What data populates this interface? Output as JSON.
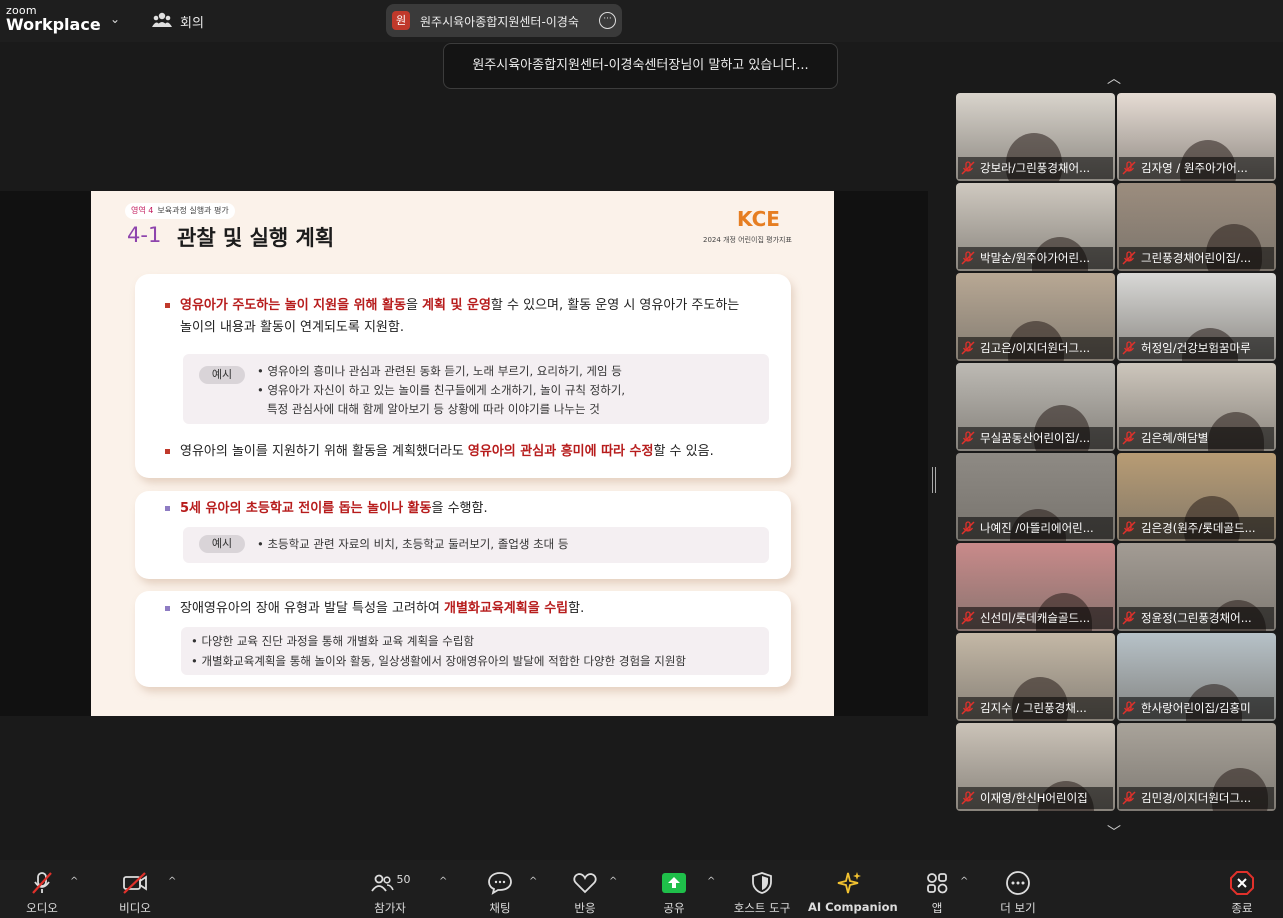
{
  "topbar": {
    "logo_small": "zoom",
    "logo_big": "Workplace",
    "meeting_label": "회의",
    "speaker_avatar": "원",
    "speaker_name": "원주시육아종합지원센터-이경숙"
  },
  "toast": "원주시육아종합지원센터-이경숙센터장님이 말하고 있습니다...",
  "slide": {
    "tag_area": "영역 4",
    "tag_text": "보육과정 실행과 평가",
    "number": "4-1",
    "title": "관찰 및 실행 계획",
    "logo": "KCE",
    "logo_sub": "2024 개정 어린이집 평가지표",
    "card1": {
      "b1_r1": "영유아가 주도하는 놀이 지원을 위해 활동",
      "b1_n1": "을 ",
      "b1_r2": "계획 및 운영",
      "b1_n2": "할 수 있으며, 활동 운영 시 영유아가 주도하는",
      "b1_line2": "놀이의 내용과 활동이 연계되도록 지원함.",
      "example_label": "예시",
      "ex_line1": "• 영유아의 흥미나 관심과 관련된 동화 듣기, 노래 부르기, 요리하기, 게임 등",
      "ex_line2": "• 영유아가 자신이 하고 있는 놀이를 친구들에게 소개하기, 놀이 규칙 정하기,",
      "ex_line3": "특정 관심사에 대해 함께 알아보기 등 상황에 따라 이야기를 나누는 것",
      "b2_n1": "영유아의 놀이를 지원하기 위해 활동을 계획했더라도 ",
      "b2_r1": "영유아의 관심과 흥미에 따라 수정",
      "b2_n2": "할 수 있음."
    },
    "card2": {
      "b_r1": "5세 유아의 초등학교 전이를 돕는 놀이나 활동",
      "b_n1": "을 수행함.",
      "example_label": "예시",
      "ex_line1": "• 초등학교 관련 자료의 비치, 초등학교 둘러보기,  졸업생 초대 등"
    },
    "card3": {
      "b_n1": "장애영유아의 장애 유형과 발달 특성을 고려하여 ",
      "b_r1": "개별화교육계획을 수립",
      "b_n2": "함.",
      "ex_line1": "• 다양한 교육 진단 과정을 통해 개별화 교육 계획을 수립함",
      "ex_line2": "• 개별화교육계획을 통해 놀이와 활동, 일상생활에서 장애영유아의 발달에 적합한 다양한 경험을 지원함"
    }
  },
  "participants": [
    {
      "name": "강보라/그린풍경채어...",
      "bg": "#d9d4cc"
    },
    {
      "name": "김자영 / 원주아가어...",
      "bg": "#e6dcd4"
    },
    {
      "name": "박말순/원주아가어린...",
      "bg": "#cfc9c0"
    },
    {
      "name": "그린풍경채어린이집/...",
      "bg": "#9c8d7e"
    },
    {
      "name": "김고은/이지더원더그...",
      "bg": "#b8a894"
    },
    {
      "name": "허정임/건강보험꿈마루",
      "bg": "#d8d8d6"
    },
    {
      "name": "무실꿈동산어린이집/...",
      "bg": "#bdbab4"
    },
    {
      "name": "김은혜/해담별",
      "bg": "#cdc6bc"
    },
    {
      "name": "나예진 /아뜰리에어린...",
      "bg": "#8e8a84"
    },
    {
      "name": "김은경(원주/롯데골드...",
      "bg": "#b89c74"
    },
    {
      "name": "신선미/롯데캐슬골드...",
      "bg": "#c98a8a"
    },
    {
      "name": "정윤정(그린풍경채어...",
      "bg": "#a39c94"
    },
    {
      "name": "김지수 / 그린풍경채...",
      "bg": "#c4b8a6"
    },
    {
      "name": "한사랑어린이집/김홍미",
      "bg": "#b7c2c8"
    },
    {
      "name": "이재영/한신H어린이집",
      "bg": "#cbc3b8"
    },
    {
      "name": "김민경/이지더원더그...",
      "bg": "#a9a39a"
    }
  ],
  "toolbar": {
    "audio": "오디오",
    "video": "비디오",
    "participants_count": "50",
    "participants": "참가자",
    "chat": "채팅",
    "reactions": "반응",
    "share": "공유",
    "host_tools": "호스트 도구",
    "ai_companion": "AI Companion",
    "apps": "앱",
    "more": "더 보기",
    "end": "종료"
  },
  "colors": {
    "share_green": "#1fbf4a",
    "end_red": "#e0312b",
    "muted_red": "#e0312b",
    "ai_yellow": "#f2c230"
  }
}
